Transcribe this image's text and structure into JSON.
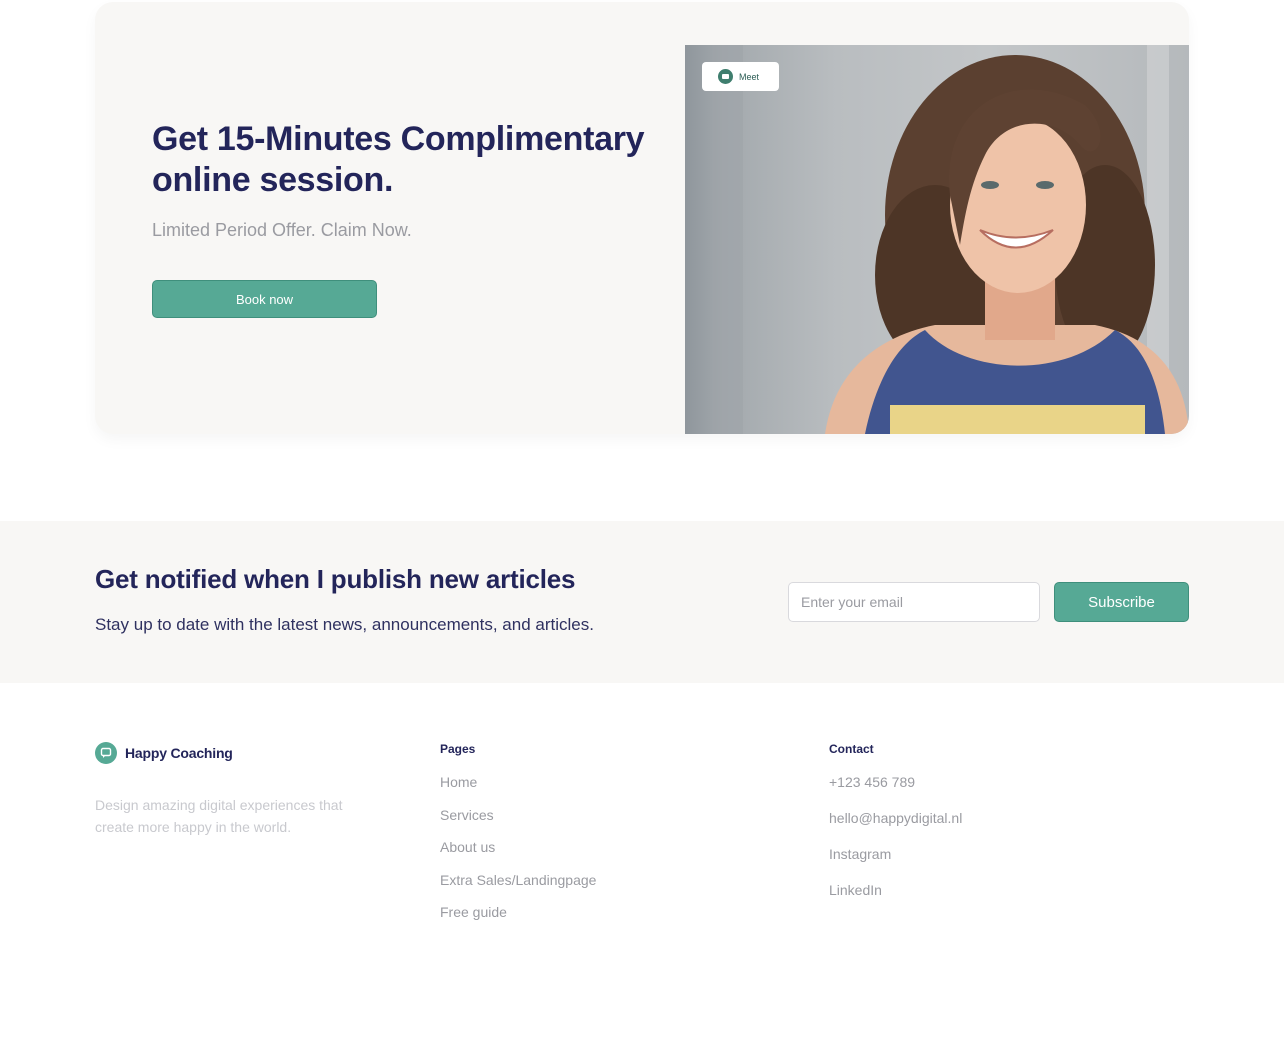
{
  "promo": {
    "title_line1": "Get 15-Minutes Complimentary",
    "title_line2": "online session.",
    "subtitle": "Limited Period Offer. Claim Now.",
    "button_label": "Book now",
    "meet_label": "Meet",
    "accent": "#56a995",
    "background": "#f8f7f5"
  },
  "newsletter": {
    "title": "Get notified when I publish new articles",
    "subtitle": "Stay up to date with the latest news, announcements, and articles.",
    "email_placeholder": "Enter your email",
    "email_value": "",
    "button_label": "Subscribe"
  },
  "footer": {
    "brand": {
      "name": "Happy Coaching",
      "description": "Design amazing digital experiences that create more happy in the world.",
      "icon": "chat-bubble-icon"
    },
    "pages": {
      "heading": "Pages",
      "links": [
        "Home",
        "Services",
        "About us",
        "Extra Sales/Landingpage",
        "Free guide"
      ]
    },
    "contact": {
      "heading": "Contact",
      "links": [
        "+123 456 789",
        "hello@happydigital.nl",
        "Instagram",
        "LinkedIn"
      ]
    }
  },
  "colors": {
    "primary_text": "#23255a",
    "muted_text": "#9a9ba1",
    "accent": "#56a995"
  }
}
